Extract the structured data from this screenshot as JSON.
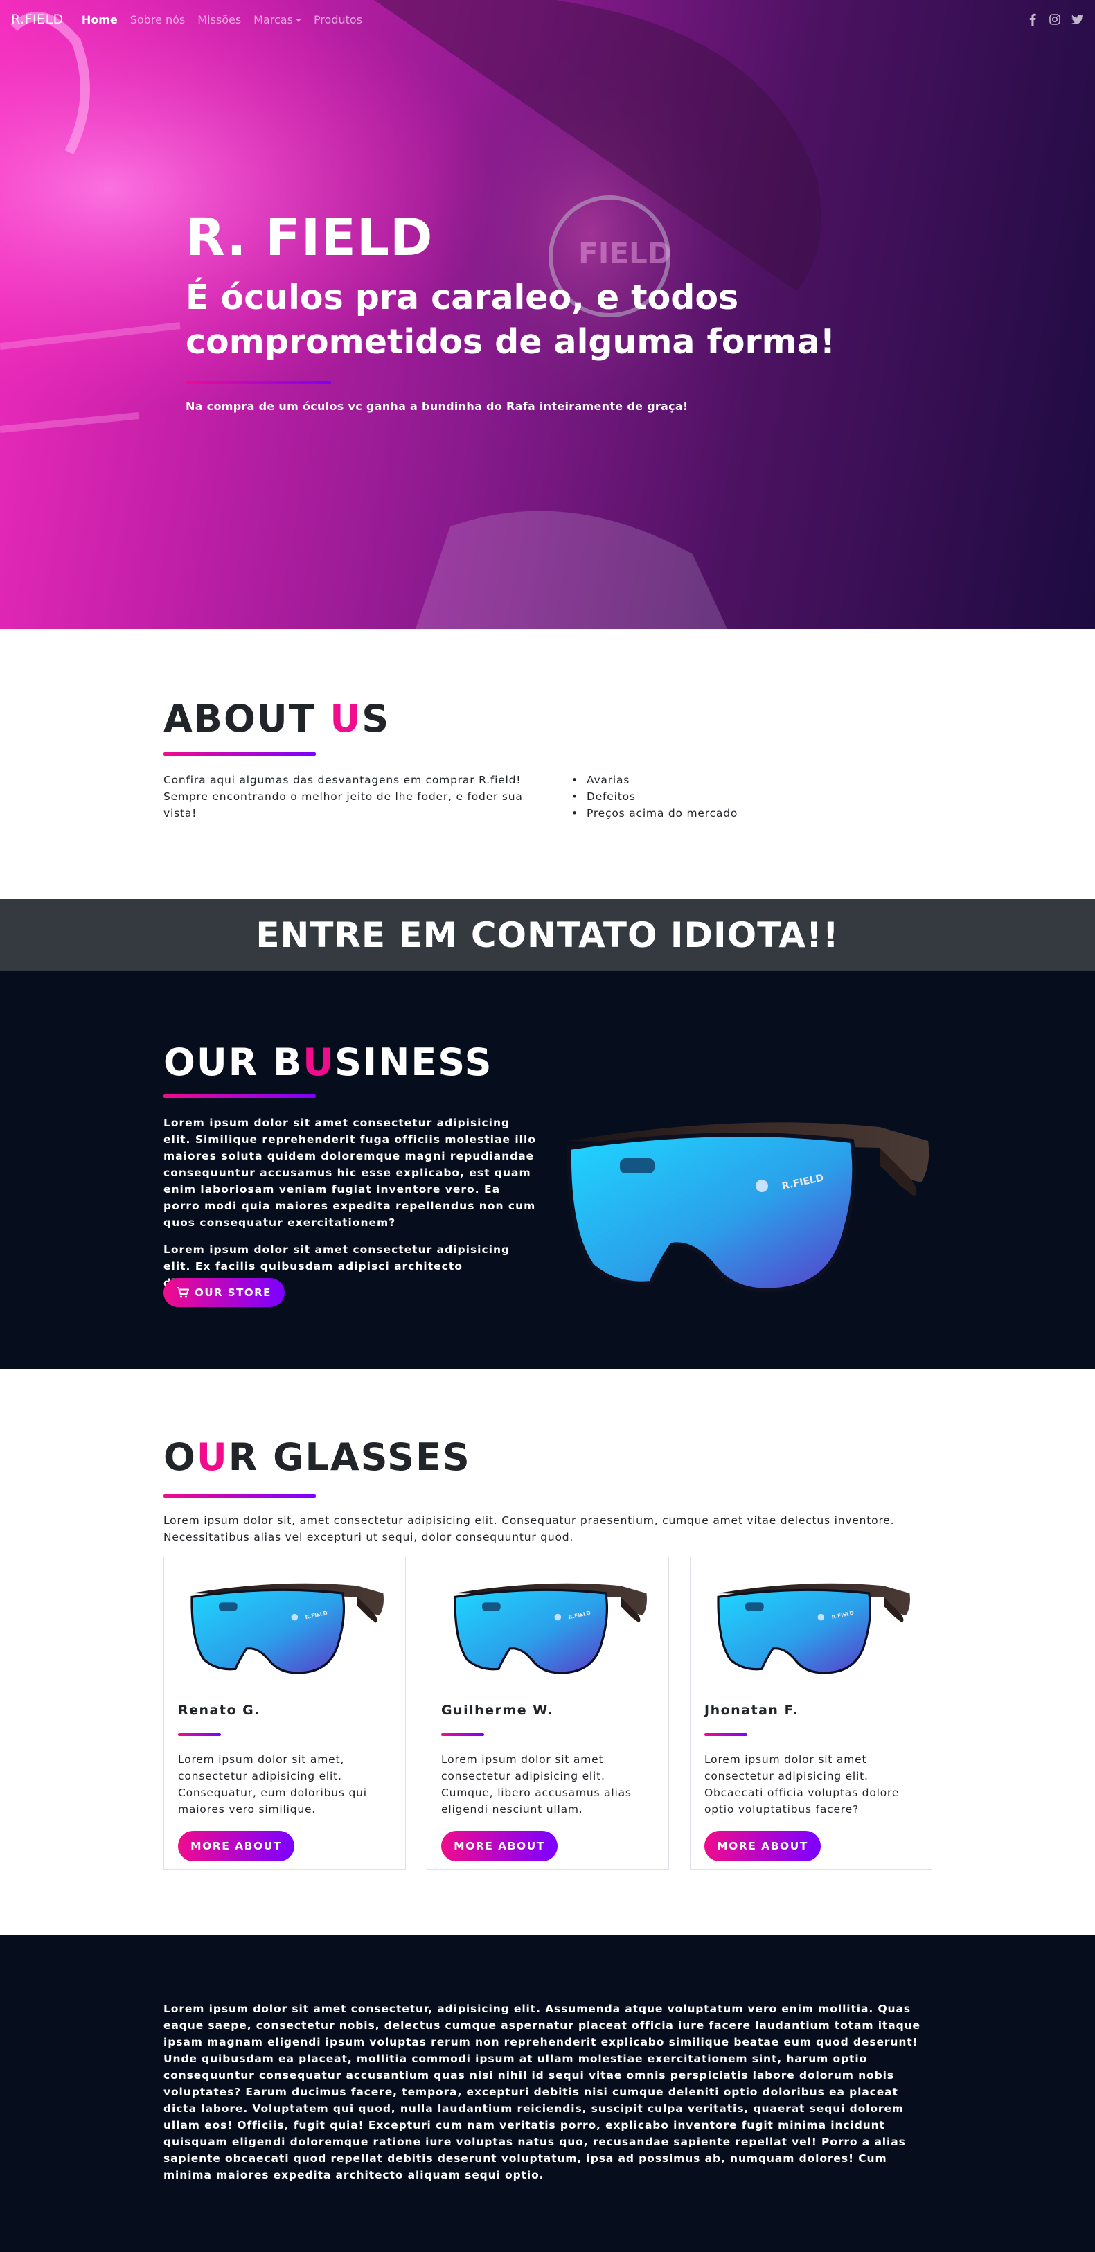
{
  "nav": {
    "brand": "R.FIELD",
    "links": [
      {
        "label": "Home"
      },
      {
        "label": "Sobre nós"
      },
      {
        "label": "Missões"
      },
      {
        "label": "Marcas"
      },
      {
        "label": "Produtos"
      }
    ],
    "social_icons": [
      "facebook-icon",
      "instagram-icon",
      "twitter-icon"
    ]
  },
  "hero": {
    "logo": "R. FIELD",
    "title": "É óculos pra caraleo, e todos comprometidos de alguma forma!",
    "subtitle": "Na compra de um óculos vc ganha a bundinha do Rafa inteiramente de graça!"
  },
  "about": {
    "title_start": "ABOUT ",
    "title_highlight": "U",
    "title_end": "S",
    "text": "Confira aqui algumas das desvantagens em comprar R.field! Sempre encontrando o melhor jeito de lhe foder, e foder sua vista!",
    "list": [
      "Avarias",
      "Defeitos",
      "Preços acima do mercado"
    ]
  },
  "contact": {
    "banner": "ENTRE EM CONTATO IDIOTA!!"
  },
  "business": {
    "title_start": "OUR B",
    "title_highlight": "U",
    "title_end": "SINESS",
    "paragraph1": "Lorem ipsum dolor sit amet consectetur adipisicing elit. Similique reprehenderit fuga officiis molestiae illo maiores soluta quidem doloremque magni repudiandae consequuntur accusamus hic esse explicabo, est quam enim laboriosam veniam fugiat inventore vero. Ea porro modi quia maiores expedita repellendus non cum quos consequatur exercitationem?",
    "paragraph2": "Lorem ipsum dolor sit amet consectetur adipisicing elit. Ex facilis quibusdam adipisci architecto dignissimos esse.",
    "store_button": "OUR STORE"
  },
  "glasses": {
    "title_start": "O",
    "title_highlight": "U",
    "title_end": "R GLASSES",
    "intro": "Lorem ipsum dolor sit, amet consectetur adipisicing elit. Consequatur praesentium, cumque amet vitae delectus inventore. Necessitatibus alias vel excepturi ut sequi, dolor consequuntur quod.",
    "cards": [
      {
        "name": "Renato G.",
        "text": "Lorem ipsum dolor sit amet, consectetur adipisicing elit. Consequatur, eum doloribus qui maiores vero similique.",
        "button": "MORE ABOUT"
      },
      {
        "name": "Guilherme W.",
        "text": "Lorem ipsum dolor sit amet consectetur adipisicing elit. Cumque, libero accusamus alias eligendi nesciunt ullam.",
        "button": "MORE ABOUT"
      },
      {
        "name": "Jhonatan F.",
        "text": "Lorem ipsum dolor sit amet consectetur adipisicing elit. Obcaecati officia voluptas dolore optio voluptatibus facere?",
        "button": "MORE ABOUT"
      }
    ]
  },
  "footer": {
    "text": "Lorem ipsum dolor sit amet consectetur, adipisicing elit. Assumenda atque voluptatum vero enim mollitia. Quas eaque saepe, consectetur nobis, delectus cumque aspernatur placeat officia iure facere laudantium totam itaque ipsam magnam eligendi ipsum voluptas rerum non reprehenderit explicabo similique beatae eum quod deserunt! Unde quibusdam ea placeat, mollitia commodi ipsum at ullam molestiae exercitationem sint, harum optio consequuntur consequatur accusantium quas nisi nihil id sequi vitae omnis perspiciatis labore dolorum nobis voluptates? Earum ducimus facere, tempora, excepturi debitis nisi cumque deleniti optio doloribus ea placeat dicta labore. Voluptatem qui quod, nulla laudantium reiciendis, suscipit culpa veritatis, quaerat sequi dolorem ullam eos! Officiis, fugit quia! Excepturi cum nam veritatis porro, explicabo inventore fugit minima incidunt quisquam eligendi doloremque ratione iure voluptas natus quo, recusandae sapiente repellat vel! Porro a alias sapiente obcaecati quod repellat debitis deserunt voluptatum, ipsa ad possimus ab, numquam dolores! Cum minima maiores expedita architecto aliquam sequi optio."
  },
  "colors": {
    "accent_pink": "#f00c8d",
    "accent_purple": "#7b00ff",
    "dark_navy": "#060d1c",
    "banner_gray": "#343a40"
  }
}
